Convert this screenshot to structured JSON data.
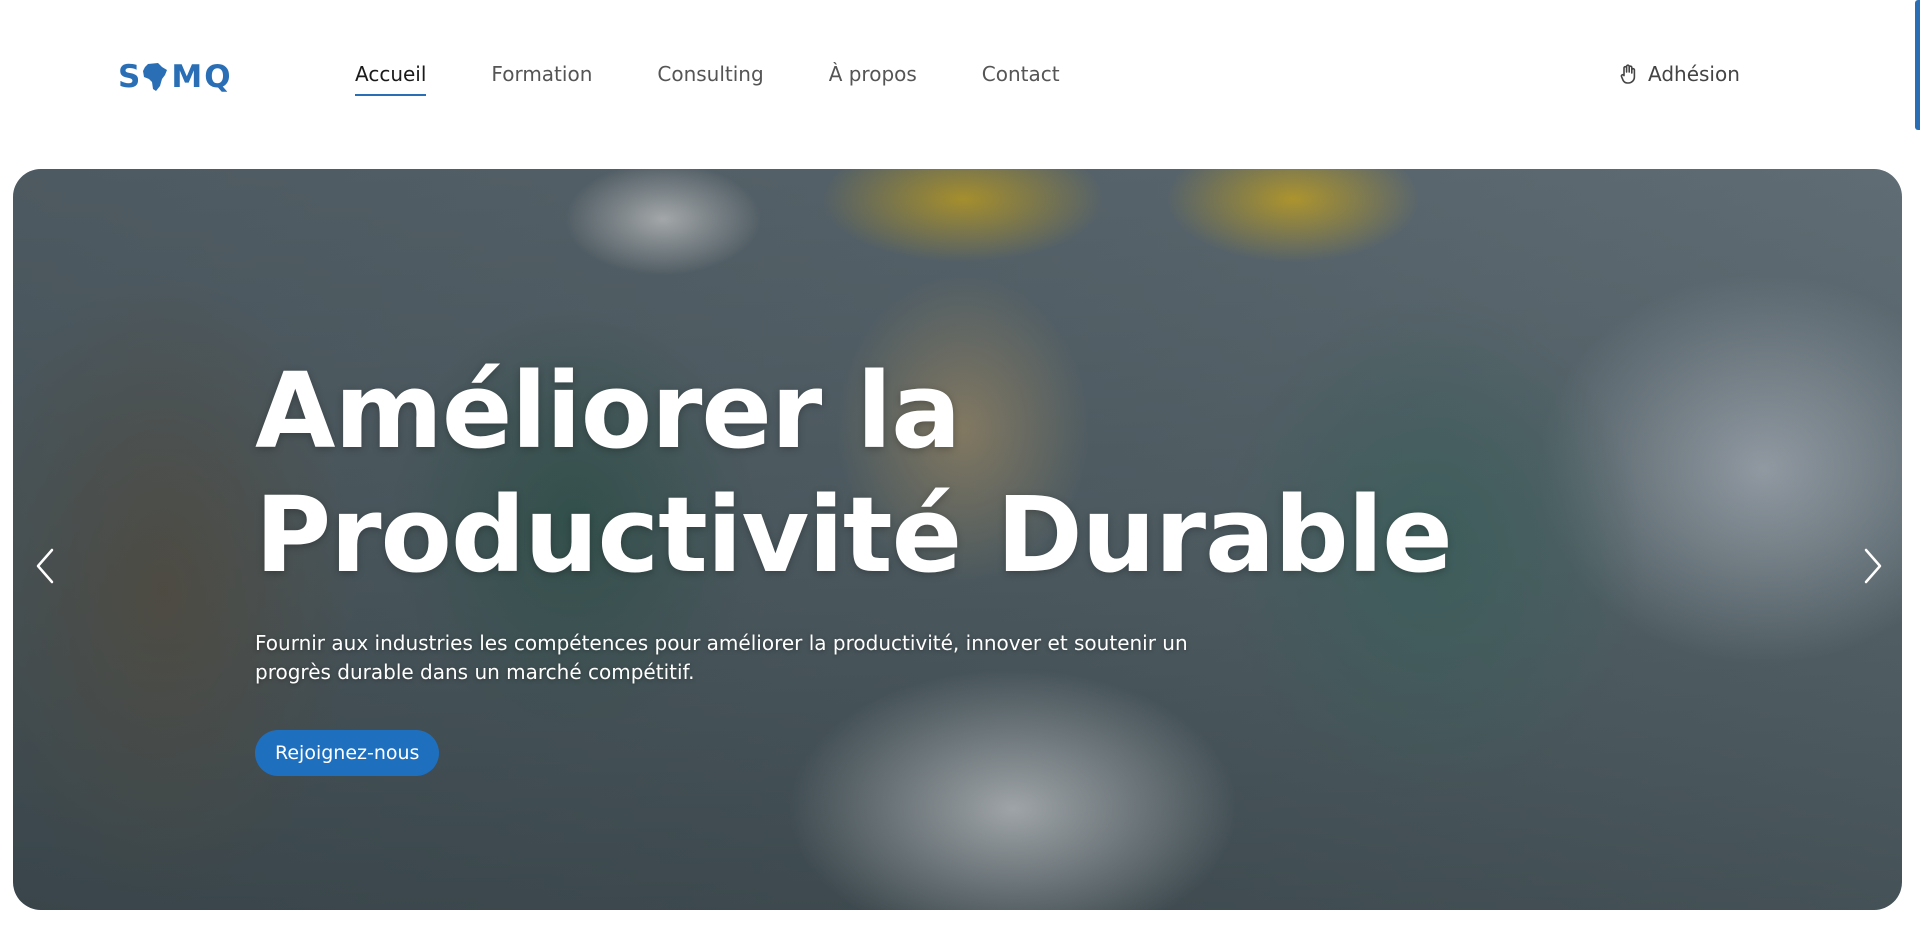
{
  "header": {
    "logo": {
      "alt": "SAMQ logo",
      "letters": [
        "S",
        "",
        "M",
        "Q"
      ]
    },
    "nav": [
      {
        "label": "Accueil",
        "active": true
      },
      {
        "label": "Formation",
        "active": false
      },
      {
        "label": "Consulting",
        "active": false
      },
      {
        "label": "À propos",
        "active": false
      },
      {
        "label": "Contact",
        "active": false
      }
    ],
    "adhesion": {
      "label": "Adhésion",
      "icon": "hand-icon"
    }
  },
  "hero": {
    "title": "Améliorer la Productivité Durable",
    "subtitle": "Fournir aux industries les compétences pour améliorer la productivité, innover et soutenir un progrès durable dans un marché compétitif.",
    "cta_label": "Rejoignez-nous",
    "prev_icon": "chevron-left-icon",
    "next_icon": "chevron-right-icon"
  },
  "colors": {
    "accent": "#1f6fbf",
    "logo": "#2a6fb5",
    "text": "#555555"
  }
}
